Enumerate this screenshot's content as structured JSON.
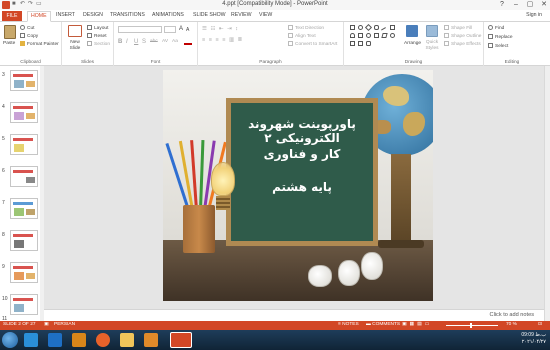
{
  "window": {
    "title": "4.ppt [Compatibility Mode] - PowerPoint",
    "controls": [
      "?",
      "–",
      "▢",
      "✕"
    ]
  },
  "tabs": {
    "items": [
      "FILE",
      "HOME",
      "INSERT",
      "DESIGN",
      "TRANSITIONS",
      "ANIMATIONS",
      "SLIDE SHOW",
      "REVIEW",
      "VIEW"
    ],
    "active": "HOME",
    "signin": "Sign in"
  },
  "ribbon": {
    "clipboard": {
      "paste": "Paste",
      "cut": "Cut",
      "copy": "Copy",
      "format_painter": "Format Painter",
      "label": "Clipboard"
    },
    "slides": {
      "new_slide": "New Slide",
      "layout": "Layout",
      "reset": "Reset",
      "section": "Section",
      "label": "Slides"
    },
    "font": {
      "label": "Font",
      "bold": "B",
      "italic": "I",
      "underline": "U",
      "strike": "S",
      "shadow": "abc",
      "spacing": "AV",
      "case": "Aa",
      "size_up": "A",
      "size_down": "A"
    },
    "paragraph": {
      "label": "Paragraph",
      "text_direction": "Text Direction",
      "align_text": "Align Text",
      "smartart": "Convert to SmartArt"
    },
    "drawing": {
      "label": "Drawing",
      "arrange": "Arrange",
      "quick_styles": "Quick Styles",
      "shape_fill": "Shape Fill",
      "shape_outline": "Shape Outline",
      "shape_effects": "Shape Effects"
    },
    "editing": {
      "label": "Editing",
      "find": "Find",
      "replace": "Replace",
      "select": "Select"
    }
  },
  "thumbnails": [
    "3",
    "4",
    "5",
    "6",
    "7",
    "8",
    "9",
    "10",
    "11"
  ],
  "slide": {
    "line1": "پاورپوینت شهروند الکترونیکی ۲",
    "line2": "کار و فناوری",
    "line3": "پایه هشتم"
  },
  "notes": {
    "placeholder": "Click to add notes"
  },
  "status": {
    "slide": "SLIDE 2 OF 27",
    "language": "PERSIAN",
    "notes": "NOTES",
    "comments": "COMMENTS",
    "zoom": "70 %"
  },
  "taskbar": {
    "time": "09:09 ب.ظ",
    "date": "۲۰۲۱/۰۴/۲۷"
  }
}
